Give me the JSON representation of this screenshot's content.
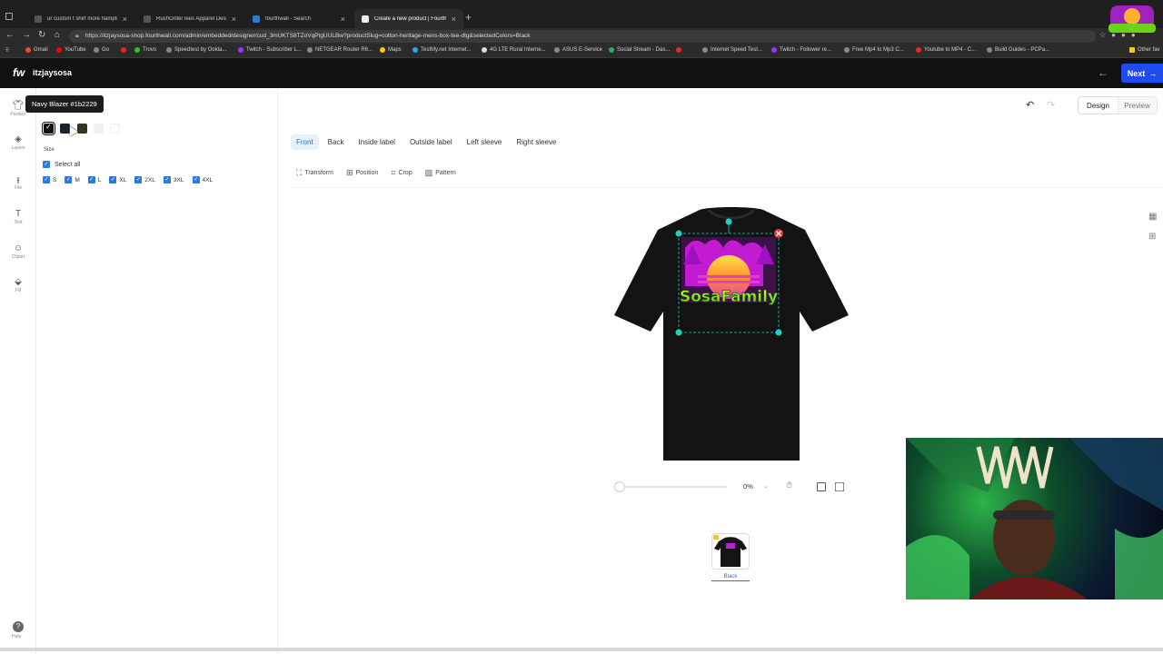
{
  "browser": {
    "tabs": [
      {
        "label": "ur custom t shirt more hampton"
      },
      {
        "label": "RushOrderTees Apparel Design St"
      },
      {
        "label": "fourthwall - Search"
      },
      {
        "label": "Create a new product | Fourthwall"
      }
    ],
    "url": "https://itzjaysosa-shop.fourthwall.com/admin/embedded/designer/cud_3mUKTS8TZoVqPtgUULBw?productSlug=cotton-heritage-mens-box-tee-dtg&selectedColors=Black",
    "bookmarks": [
      "Gmail",
      "YouTube",
      "Go",
      "Trovo",
      "Speedtest by Ookla...",
      "Twitch - Subscriber L...",
      "NETGEAR Router R6...",
      "Maps",
      "TestMy.net Internet...",
      "4G LTE Rural Interne...",
      "ASUS E-Service",
      "Social Stream - Das...",
      "Internet Speed Test...",
      "Twitch - Follower re...",
      "Free Mp4 to Mp3 C...",
      "Youtube to MP4 - C...",
      "Build Guides - PCPa...",
      "Other fav"
    ]
  },
  "header": {
    "logo": "fw",
    "shop_name": "itzjaysosa",
    "next_label": "Next"
  },
  "rail": {
    "items": [
      {
        "icon": "tshirt-icon",
        "label": "Product"
      },
      {
        "icon": "layers-icon",
        "label": "Layers"
      },
      {
        "icon": "upload-icon",
        "label": "File"
      },
      {
        "icon": "text-icon",
        "label": "Text"
      },
      {
        "icon": "clipart-icon",
        "label": "Clipart"
      },
      {
        "icon": "fill-icon",
        "label": "Fill"
      }
    ],
    "help_label": "Help"
  },
  "options": {
    "tooltip": "Navy Blazer #1b2229",
    "colors": [
      {
        "name": "Black",
        "hex": "#111111"
      },
      {
        "name": "Navy Blazer",
        "hex": "#1b2229"
      },
      {
        "name": "Dark",
        "hex": "#3a3424"
      },
      {
        "name": "Light",
        "hex": "#f1f1f1"
      },
      {
        "name": "White",
        "hex": "#ffffff"
      }
    ],
    "size_heading": "Size",
    "select_all": "Select all",
    "sizes": [
      "S",
      "M",
      "L",
      "XL",
      "2XL",
      "3XL",
      "4XL"
    ]
  },
  "toolbar": {
    "design": "Design",
    "preview": "Preview"
  },
  "placements": [
    "Front",
    "Back",
    "Inside label",
    "Outside label",
    "Left sleeve",
    "Right sleeve"
  ],
  "tools": [
    "Transform",
    "Position",
    "Crop",
    "Pattern"
  ],
  "design_text": "SosaFamily",
  "zoom": {
    "value": "0%"
  },
  "thumbnail": {
    "label": "Black"
  },
  "colors": {
    "accent": "#2a6fd1",
    "next": "#1f4cf0",
    "selection": "#19d3c5"
  }
}
